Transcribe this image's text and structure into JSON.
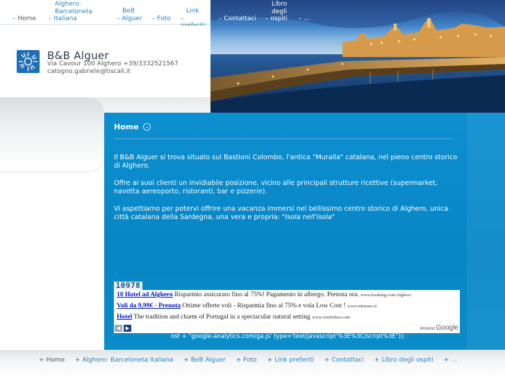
{
  "nav": {
    "items": [
      {
        "label": "Home"
      },
      {
        "label_lines": [
          "Alghero:",
          "Barceloneta",
          "Italiana"
        ]
      },
      {
        "label_lines": [
          "BeB",
          "Alguer"
        ]
      },
      {
        "label": "Foto"
      },
      {
        "label_lines": [
          "Link",
          "preferiti"
        ]
      },
      {
        "label": "Contattaci"
      },
      {
        "label_lines": [
          "Libro",
          "degli",
          "ospiti"
        ]
      },
      {
        "label": "..."
      }
    ]
  },
  "site": {
    "title": "B&B Alguer",
    "address": "Via Cavour 100 Alghero +39/3332521567",
    "email": "catogno.gabriele@tiscali.it",
    "logo_icon": "sun-logo-icon"
  },
  "page": {
    "title": "Home",
    "paragraphs": [
      "Il B&B Alguer si trova situato sui Bastioni Colombo, l'antica \"Muralla\" catalana, nel pieno centro storico di Alghero.",
      "Offre ai suoi clienti un invidiabile posizione, vicino alle principali strutture ricettive  (supermarket, navetta aereoporto, ristoranti, bar e pizzerie).",
      "Vi aspettiamo per potervi offrire una vacanza immersi nel bellissimo centro storico di Alghero, unica città catalana della Sardegna, una vera e propria: \"",
      "Isola nell'isola",
      "\""
    ]
  },
  "counter": "10978",
  "ads": [
    {
      "link": "10 Hotel ad Alghero",
      "text": " Risparmio assicurato fino al 75%! Pagamento in albergo. Prenota ora. ",
      "url": "www.booking.com/Alghero"
    },
    {
      "link": "Voli da 9,99€ - Prenota",
      "text": " Ottime offerte voli - Risparmia fino al 75% e vola Low Cost ! ",
      "url": "www.edreams.it"
    },
    {
      "link": "Hotel",
      "text": " The tradition and charm of Portugal in a spectacular natural setting ",
      "url": "www.visitlisboa.com"
    }
  ],
  "ad_footer": {
    "annunci": "Annunci",
    "google": "Google",
    "prev_icon": "arrow-left-icon",
    "next_icon": "arrow-right-icon"
  },
  "js_leak": "ost + \"google-analytics.com/ga.js' type='text/javascript'%3E%3C/script%3E\"));",
  "footer": {
    "items": [
      "Home",
      "Alghero: Barceloneta Italiana",
      "BeB Alguer",
      "Foto",
      "Link preferiti",
      "Contattaci",
      "Libro degli ospiti",
      "..."
    ]
  },
  "colors": {
    "accent": "#0c8fd0",
    "link": "#2a7fc0",
    "ad_link": "#0018c6"
  }
}
